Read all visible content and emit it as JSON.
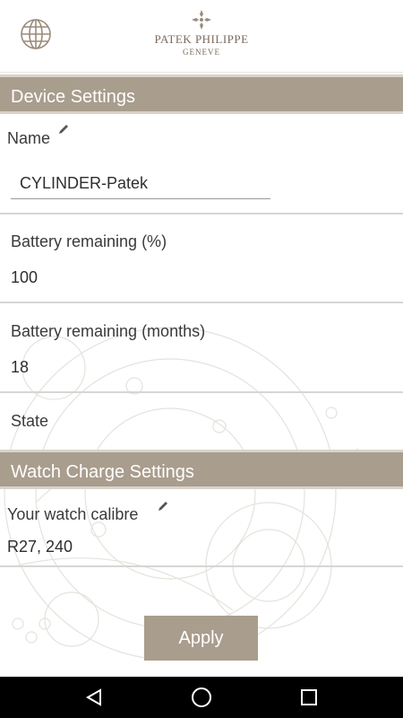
{
  "brand": {
    "name": "PATEK PHILIPPE",
    "city": "GENEVE",
    "icon": "globe-icon",
    "logo_icon": "calatrava-cross-icon"
  },
  "device_settings": {
    "header": "Device Settings",
    "name_label": "Name",
    "name_value": "CYLINDER-Patek",
    "battery_percent_label": "Battery remaining (%)",
    "battery_percent_value": "100",
    "battery_months_label": "Battery remaining (months)",
    "battery_months_value": "18",
    "state_label": "State"
  },
  "watch_charge_settings": {
    "header": "Watch Charge Settings",
    "calibre_label": "Your watch calibre",
    "calibre_value": "R27, 240"
  },
  "actions": {
    "apply_label": "Apply"
  },
  "navbar": {
    "icons": [
      "back-icon",
      "home-icon",
      "recents-icon"
    ]
  },
  "colors": {
    "accent": "#a99d8d",
    "brand_text": "#7a6a5c",
    "navbar": "#000000"
  }
}
